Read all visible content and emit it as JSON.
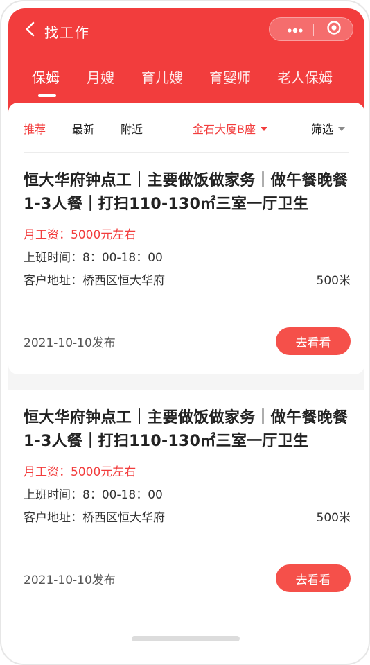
{
  "header": {
    "title": "找工作",
    "icons": {
      "back": "chevron-left-icon",
      "more": "more-dots-icon",
      "close": "target-close-icon"
    },
    "accent_color": "#f23d3d"
  },
  "tabs": [
    "保姆",
    "月嫂",
    "育儿嫂",
    "育婴师",
    "老人保姆"
  ],
  "active_tab": "保姆",
  "filter": {
    "recommend": "推荐",
    "latest": "最新",
    "nearby": "附近",
    "location": "金石大厦B座",
    "screen": "筛选"
  },
  "jobs": [
    {
      "title": "恒大华府钟点工｜主要做饭做家务｜做午餐晚餐1-3人餐｜打扫110-130㎡三室一厅卫生",
      "salary": "月工资：5000元左右",
      "hours": "上班时间：8：00-18：00",
      "address": "客户地址：桥西区恒大华府",
      "distance": "500米",
      "posted": "2021-10-10发布",
      "action": "去看看"
    },
    {
      "title": "恒大华府钟点工｜主要做饭做家务｜做午餐晚餐1-3人餐｜打扫110-130㎡三室一厅卫生",
      "salary": "月工资：5000元左右",
      "hours": "上班时间：8：00-18：00",
      "address": "客户地址：桥西区恒大华府",
      "distance": "500米",
      "posted": "2021-10-10发布",
      "action": "去看看"
    }
  ]
}
